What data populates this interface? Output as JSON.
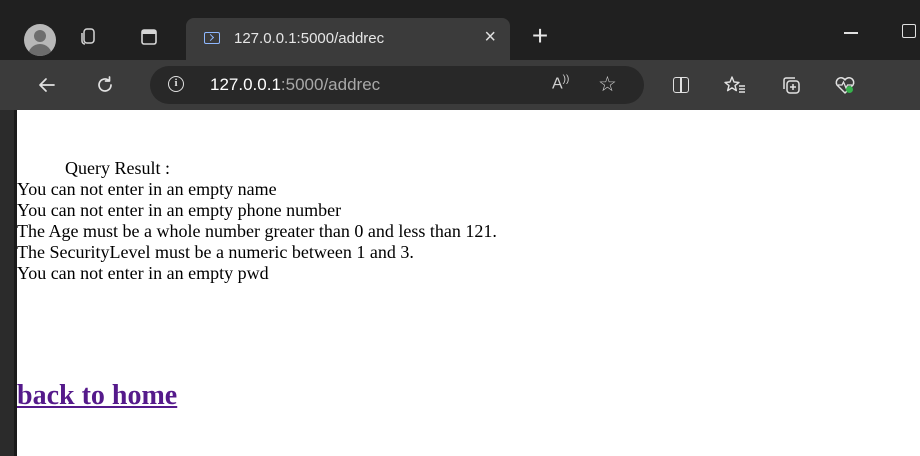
{
  "browser": {
    "tab": {
      "title": "127.0.0.1:5000/addrec",
      "close_glyph": "×"
    },
    "new_tab_glyph": "+",
    "address": {
      "host": "127.0.0.1",
      "path": ":5000/addrec"
    },
    "read_aloud_glyph": "A",
    "favorite_glyph": "☆",
    "icons": [
      "profile-icon",
      "workspaces-icon",
      "tab-actions-icon",
      "favicon-icon",
      "close-icon",
      "new-tab-icon",
      "minimize-icon",
      "maximize-icon",
      "back-icon",
      "refresh-icon",
      "info-icon",
      "read-aloud-icon",
      "favorite-star-icon",
      "split-screen-icon",
      "favorites-icon",
      "collections-icon",
      "browser-essentials-icon"
    ]
  },
  "page": {
    "query_label": "Query Result :",
    "messages": [
      "You can not enter in an empty name",
      "You can not enter in an empty phone number",
      "The Age must be a whole number greater than 0 and less than 121.",
      "The SecurityLevel must be a numeric between 1 and 3.",
      "You can not enter in an empty pwd"
    ],
    "back_link": "back to home"
  },
  "colors": {
    "link_visited": "#551a8b",
    "chrome_dark": "#202020",
    "toolbar": "#3b3b3b"
  }
}
